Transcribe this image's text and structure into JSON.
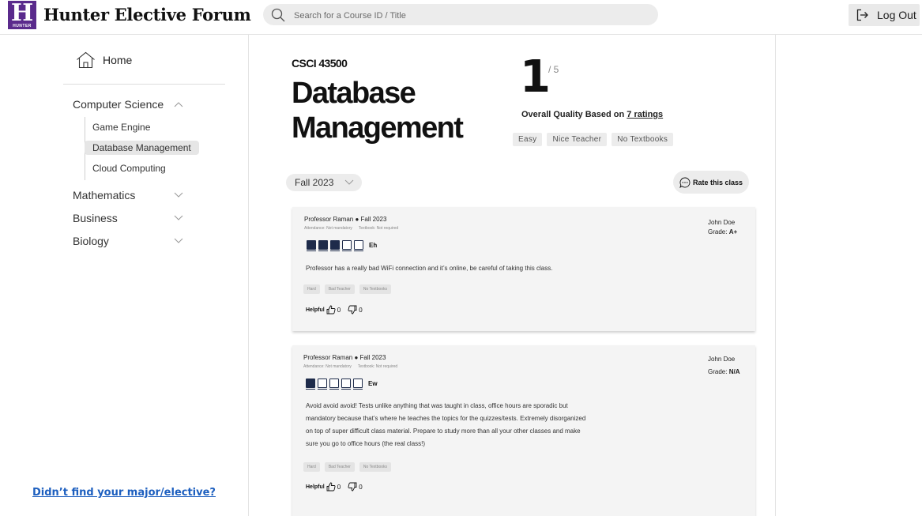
{
  "header": {
    "logo_letter": "H",
    "logo_subtext": "HUNTER",
    "brand": "Hunter Elective Forum",
    "search_placeholder": "Search for a Course ID / Title",
    "logout_label": "Log Out"
  },
  "sidebar": {
    "home_label": "Home",
    "categories": [
      {
        "label": "Computer Science",
        "expanded": true,
        "items": [
          "Game Engine",
          "Database Management",
          "Cloud Computing"
        ],
        "active_item": "Database Management"
      },
      {
        "label": "Mathematics",
        "expanded": false
      },
      {
        "label": "Business",
        "expanded": false
      },
      {
        "label": "Biology",
        "expanded": false
      }
    ],
    "not_found_link": "Didn’t find your major/elective?"
  },
  "course": {
    "code": "CSCI 43500",
    "title": "Database Management",
    "rating": "1",
    "rating_max": "/ 5",
    "quality_prefix": "Overall Quality Based on ",
    "ratings_link": "7 ratings",
    "tags": [
      "Easy",
      "Nice Teacher",
      "No Textbooks"
    ],
    "term_filter": "Fall 2023",
    "rate_button": "Rate this class"
  },
  "reviews": [
    {
      "professor": "Professor Raman",
      "term": "Fall 2023",
      "attendance": "Attendance: Not mandatory",
      "textbook": "Textbook: Not required",
      "user": "John Doe",
      "grade_label": "Grade: ",
      "grade": "A+",
      "rating": 3,
      "rating_max": 5,
      "rating_word": "Eh",
      "text_lines": [
        "Professor has a really bad WiFi connection and it’s online, be careful of taking this class."
      ],
      "tags": [
        "Hard",
        "Bad Teacher",
        "No Textbooks"
      ],
      "helpful_label": "Helpful",
      "thumbs_up": "0",
      "thumbs_down": "0"
    },
    {
      "professor": "Professor Raman",
      "term": "Fall 2023",
      "attendance": "Attendance: Not mandatory",
      "textbook": "Textbook: Not required",
      "user": "John Doe",
      "grade_label": "Grade: ",
      "grade": "N/A",
      "rating": 1,
      "rating_max": 5,
      "rating_word": "Ew",
      "text_lines": [
        "Avoid avoid avoid! Tests unlike anything that was taught in class, office hours are sporadic but",
        "mandatory because that’s where he teaches the topics for the quizzes/tests. Extremely disorganized",
        "on top of super difficult class material. Prepare to study more than all your other classes and make",
        "sure you go to office hours (the real class!)"
      ],
      "tags": [
        "Hard",
        "Bad Teacher",
        "No Textbooks"
      ],
      "helpful_label": "Helpful",
      "thumbs_up": "0",
      "thumbs_down": "0"
    }
  ]
}
